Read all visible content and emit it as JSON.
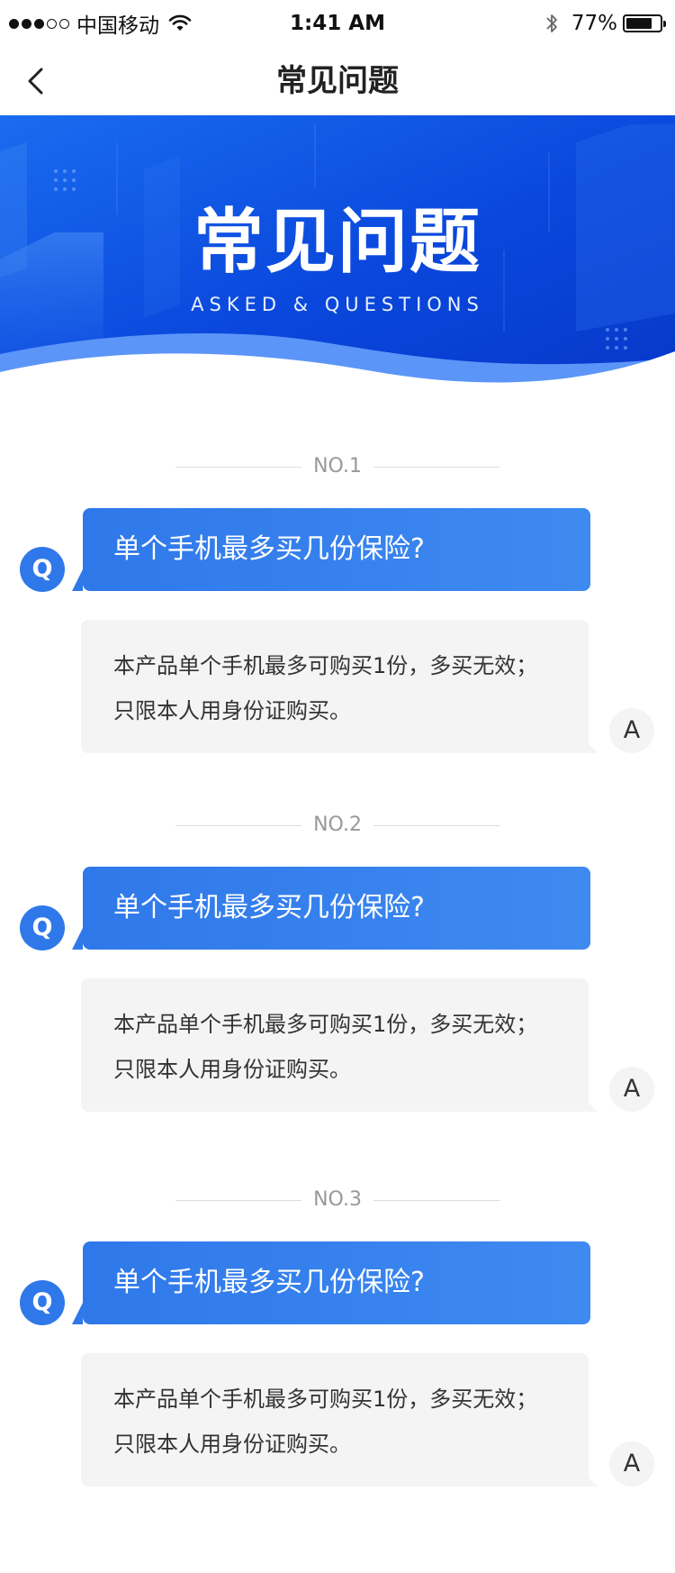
{
  "status_bar": {
    "carrier": "中国移动",
    "time": "1:41 AM",
    "battery_percent": "77%",
    "battery_level": 0.77,
    "signal_bars_filled": 3,
    "signal_bars_total": 5
  },
  "nav": {
    "title": "常见问题",
    "back_icon": "chevron-left-icon"
  },
  "banner": {
    "title": "常见问题",
    "subtitle": "ASKED & QUESTIONS"
  },
  "colors": {
    "accent": "#2f78ea",
    "banner_dark": "#0a3fd6",
    "answer_bg": "#f4f4f4"
  },
  "faq": [
    {
      "number": "NO.1",
      "q_label": "Q",
      "question": "单个手机最多买几份保险?",
      "a_label": "A",
      "answer_line1": "本产品单个手机最多可购买1份，多买无效；",
      "answer_line2": "只限本人用身份证购买。"
    },
    {
      "number": "NO.2",
      "q_label": "Q",
      "question": "单个手机最多买几份保险?",
      "a_label": "A",
      "answer_line1": "本产品单个手机最多可购买1份，多买无效；",
      "answer_line2": "只限本人用身份证购买。"
    },
    {
      "number": "NO.3",
      "q_label": "Q",
      "question": "单个手机最多买几份保险?",
      "a_label": "A",
      "answer_line1": "本产品单个手机最多可购买1份，多买无效；",
      "answer_line2": "只限本人用身份证购买。"
    }
  ]
}
